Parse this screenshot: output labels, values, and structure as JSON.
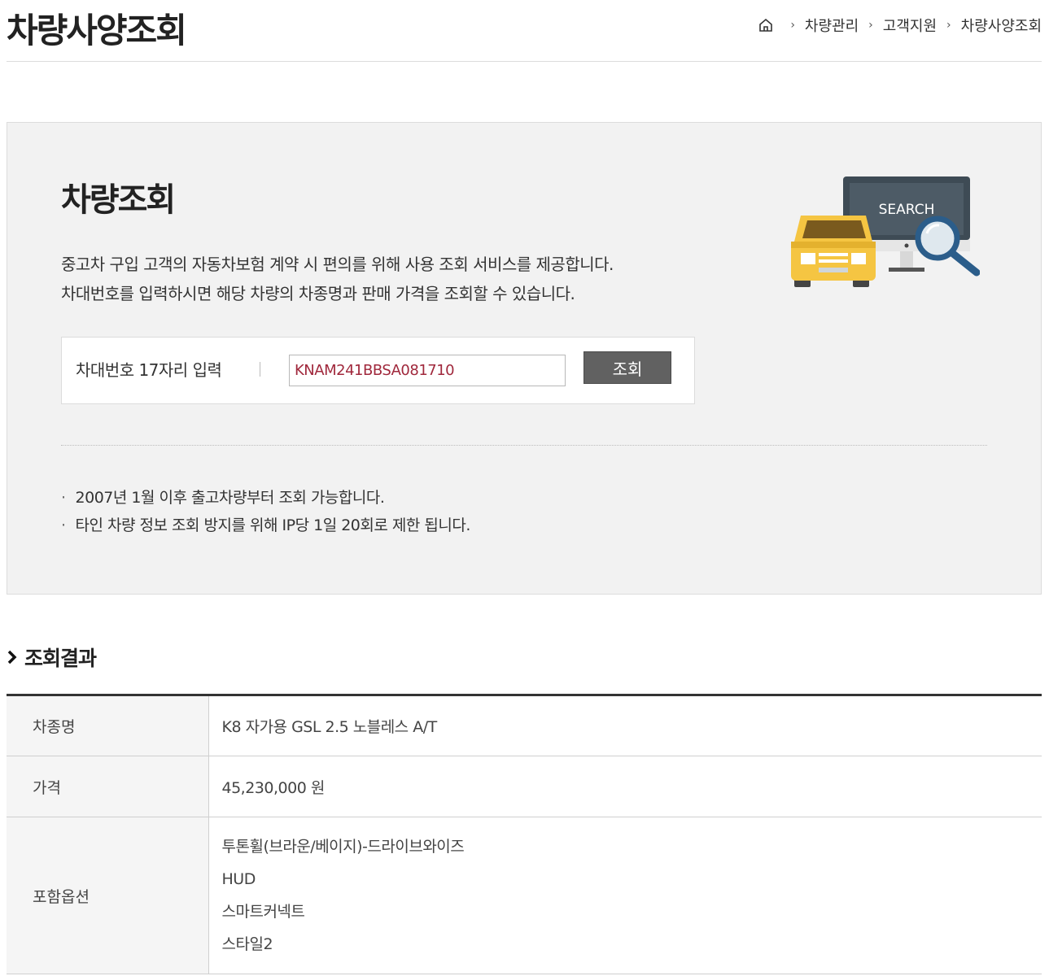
{
  "header": {
    "title": "차량사양조회",
    "breadcrumb": [
      "차량관리",
      "고객지원",
      "차량사양조회"
    ]
  },
  "search_panel": {
    "title": "차량조회",
    "description": [
      "중고차 구입 고객의 자동차보험 계약 시 편의를 위해 사용 조회 서비스를 제공합니다.",
      "차대번호를 입력하시면 해당 차량의 차종명과 판매 가격을 조회할 수 있습니다."
    ],
    "input_label": "차대번호 17자리 입력",
    "input_value": "KNAM241BBSA081710",
    "button_label": "조회",
    "notes": [
      "2007년 1월 이후 출고차량부터 조회 가능합니다.",
      "타인 차량 정보 조회 방지를 위해 IP당 1일 20회로 제한 됩니다."
    ],
    "illustration_text": "SEARCH"
  },
  "results": {
    "title": "조회결과",
    "rows": [
      {
        "label": "차종명",
        "value": "K8 자가용 GSL 2.5 노블레스 A/T"
      },
      {
        "label": "가격",
        "value": "45,230,000 원"
      }
    ],
    "options_label": "포함옵션",
    "options": [
      "투톤휠(브라운/베이지)-드라이브와이즈",
      "HUD",
      "스마트커넥트",
      "스타일2"
    ]
  },
  "colors": {
    "input_text": "#a0283c",
    "button_bg": "#616161",
    "panel_bg": "#f2f2f2",
    "car_yellow": "#f5c542",
    "monitor_dark": "#3e4b55"
  }
}
